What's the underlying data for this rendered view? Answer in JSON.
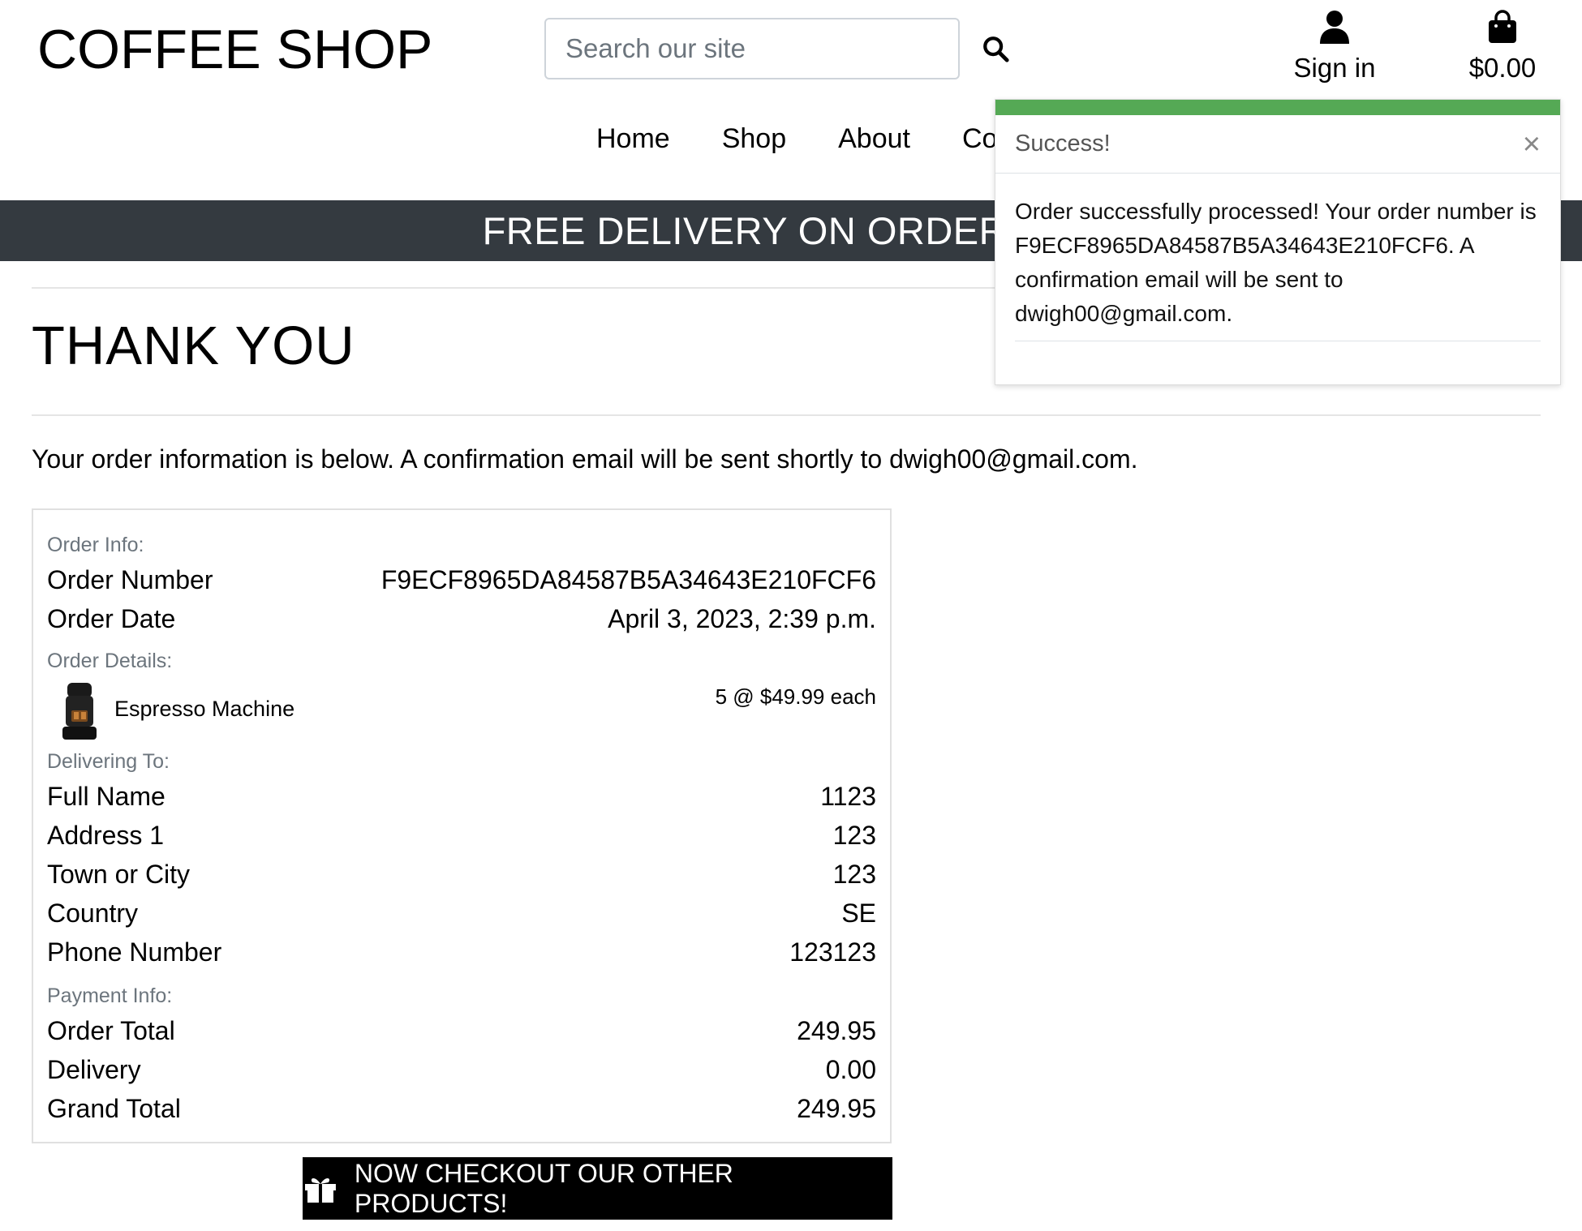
{
  "header": {
    "logo": "COFFEE SHOP",
    "search_placeholder": "Search our site",
    "account_label": "Sign in",
    "bag_total": "$0.00"
  },
  "nav": {
    "items": [
      "Home",
      "Shop",
      "About",
      "Con"
    ]
  },
  "banner": {
    "text": "FREE DELIVERY ON ORDERS OV"
  },
  "page": {
    "title": "THANK YOU",
    "intro": "Your order information is below. A confirmation email will be sent shortly to dwigh00@gmail.com."
  },
  "order": {
    "order_info_label": "Order Info:",
    "order_number_label": "Order Number",
    "order_number": "F9ECF8965DA84587B5A34643E210FCF6",
    "order_date_label": "Order Date",
    "order_date": "April 3, 2023, 2:39 p.m.",
    "order_details_label": "Order Details:",
    "item_name": "Espresso Machine",
    "item_qty": "5 @ $49.99 each",
    "delivering_label": "Delivering To:",
    "full_name_label": "Full Name",
    "full_name": "1123",
    "address1_label": "Address 1",
    "address1": "123",
    "town_label": "Town or City",
    "town": "123",
    "country_label": "Country",
    "country": "SE",
    "phone_label": "Phone Number",
    "phone": "123123",
    "payment_label": "Payment Info:",
    "order_total_label": "Order Total",
    "order_total": "249.95",
    "delivery_label": "Delivery",
    "delivery": "0.00",
    "grand_total_label": "Grand Total",
    "grand_total": "249.95"
  },
  "cta": {
    "label": "NOW CHECKOUT OUR OTHER PRODUCTS!",
    "icon": "gift-icon"
  },
  "toast": {
    "title": "Success!",
    "close": "×",
    "message": "Order successfully processed! Your order number is F9ECF8965DA84587B5A34643E210FCF6. A confirmation email will be sent to dwigh00@gmail.com.",
    "accent_color": "#55a955"
  },
  "colors": {
    "banner_bg": "#343a40",
    "cta_bg": "#000000"
  }
}
